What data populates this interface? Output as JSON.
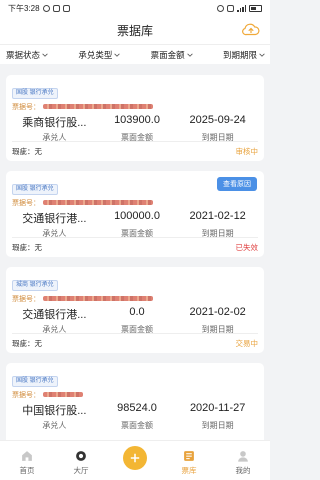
{
  "status_bar": {
    "time": "下午3:28",
    "battery": ""
  },
  "header": {
    "title": "票据库"
  },
  "filters": [
    "票据状态",
    "承兑类型",
    "票面金额",
    "到期期限"
  ],
  "cards": [
    {
      "tag": "国股 银行承兑",
      "bill_label": "票据号：",
      "acceptor": "乘商银行股...",
      "amount": "103900.0",
      "due": "2025-09-24",
      "acceptor_label": "承兑人",
      "amount_label": "票面金额",
      "due_label": "到期日期",
      "defect_label": "瑕疵：",
      "defect": "无",
      "status": "审核中",
      "status_class": "review",
      "button": ""
    },
    {
      "tag": "国股 银行承兑",
      "bill_label": "票据号：",
      "acceptor": "交通银行港...",
      "amount": "100000.0",
      "due": "2021-02-12",
      "acceptor_label": "承兑人",
      "amount_label": "票面金额",
      "due_label": "到期日期",
      "defect_label": "瑕疵：",
      "defect": "无",
      "status": "已失效",
      "status_class": "expired",
      "button": "查看原因"
    },
    {
      "tag": "城商 银行承兑",
      "bill_label": "票据号：",
      "acceptor": "交通银行港...",
      "amount": "0.0",
      "due": "2021-02-02",
      "acceptor_label": "承兑人",
      "amount_label": "票面金额",
      "due_label": "到期日期",
      "defect_label": "瑕疵：",
      "defect": "无",
      "status": "交易中",
      "status_class": "trading",
      "button": ""
    },
    {
      "tag": "国股 银行承兑",
      "bill_label": "票据号：",
      "acceptor": "中国银行股...",
      "amount": "98524.0",
      "due": "2020-11-27",
      "acceptor_label": "承兑人",
      "amount_label": "票面金额",
      "due_label": "到期日期",
      "defect_label": "",
      "defect": "",
      "status": "",
      "status_class": "",
      "button": ""
    }
  ],
  "tabbar": {
    "home": "首页",
    "hall": "大厅",
    "library": "票库",
    "mine": "我的"
  },
  "colors": {
    "accent": "#f3b634",
    "active_tab": "#e8a23c",
    "button_blue": "#4b90e6"
  }
}
